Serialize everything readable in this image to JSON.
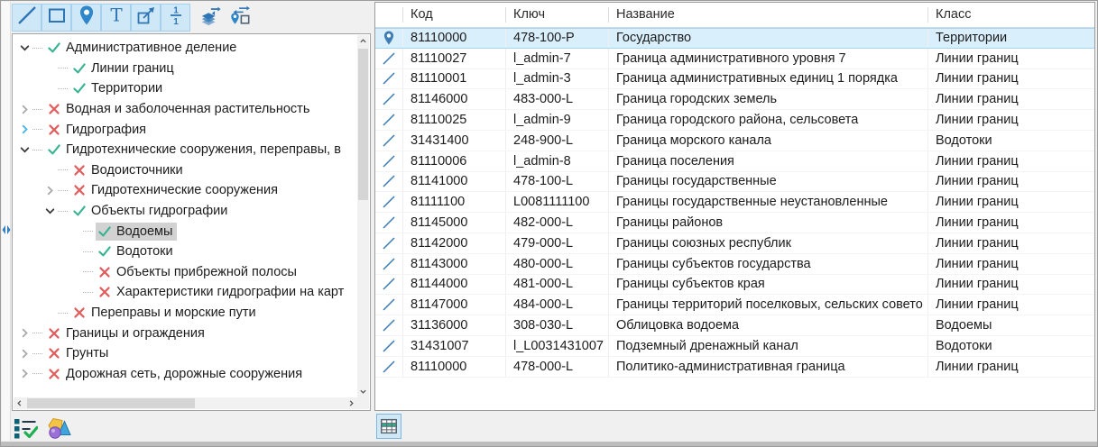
{
  "colors": {
    "accent_blue": "#2e75b6",
    "check_green": "#37b293",
    "cross_red": "#e25d5d",
    "table_selection_bg": "#daeffc",
    "tree_selection_bg": "#d2d2d2",
    "toolbar_toggle_bg": "#cfe8f8"
  },
  "toolbar": {
    "buttons": [
      {
        "id": "line-tool",
        "icon": "line",
        "active": true
      },
      {
        "id": "rectangle-tool",
        "icon": "rect",
        "active": true
      },
      {
        "id": "point-tool",
        "icon": "pin",
        "active": true
      },
      {
        "id": "text-tool",
        "icon": "text",
        "active": true
      },
      {
        "id": "vector-tool",
        "icon": "vector",
        "active": true
      },
      {
        "id": "scale-1-1-tool",
        "icon": "scale",
        "active": true
      },
      {
        "id": "layers-swap-tool",
        "icon": "layers",
        "active": false,
        "gap": true
      },
      {
        "id": "object-swap-tool",
        "icon": "pinbox",
        "active": false
      }
    ]
  },
  "tree": {
    "items": [
      {
        "label": "Административное деление",
        "level": 0,
        "expand": "open",
        "mark": "check",
        "selected": false
      },
      {
        "label": "Линии границ",
        "level": 1,
        "expand": "none",
        "mark": "check",
        "selected": false
      },
      {
        "label": "Территории",
        "level": 1,
        "expand": "none",
        "mark": "check",
        "selected": false
      },
      {
        "label": "Водная и заболоченная растительность",
        "level": 0,
        "expand": "closed",
        "mark": "cross",
        "selected": false
      },
      {
        "label": "Гидрография",
        "level": 0,
        "expand": "closed-blue",
        "mark": "cross",
        "selected": false
      },
      {
        "label": "Гидротехнические сооружения, переправы, в",
        "level": 0,
        "expand": "open",
        "mark": "check",
        "selected": false
      },
      {
        "label": "Водоисточники",
        "level": 1,
        "expand": "none",
        "mark": "cross",
        "selected": false
      },
      {
        "label": "Гидротехнические сооружения",
        "level": 1,
        "expand": "closed",
        "mark": "cross",
        "selected": false
      },
      {
        "label": "Объекты гидрографии",
        "level": 1,
        "expand": "open",
        "mark": "check",
        "selected": false
      },
      {
        "label": "Водоемы",
        "level": 2,
        "expand": "none",
        "mark": "check",
        "selected": true
      },
      {
        "label": "Водотоки",
        "level": 2,
        "expand": "none",
        "mark": "check",
        "selected": false
      },
      {
        "label": "Объекты прибрежной полосы",
        "level": 2,
        "expand": "none",
        "mark": "cross",
        "selected": false
      },
      {
        "label": "Характеристики гидрографии на карт",
        "level": 2,
        "expand": "none",
        "mark": "cross",
        "selected": false
      },
      {
        "label": "Переправы и морские пути",
        "level": 1,
        "expand": "none",
        "mark": "cross",
        "selected": false
      },
      {
        "label": "Границы и ограждения",
        "level": 0,
        "expand": "closed",
        "mark": "cross",
        "selected": false
      },
      {
        "label": "Грунты",
        "level": 0,
        "expand": "closed",
        "mark": "cross",
        "selected": false
      },
      {
        "label": "Дорожная сеть, дорожные сооружения",
        "level": 0,
        "expand": "closed",
        "mark": "cross",
        "selected": false
      }
    ]
  },
  "left_footer": {
    "icons": [
      {
        "id": "object-list-check"
      },
      {
        "id": "object-shapes"
      }
    ]
  },
  "table": {
    "columns": [
      "",
      "Код",
      "Ключ",
      "Название",
      "Класс"
    ],
    "rows": [
      {
        "icon": "pin",
        "code": "81110000",
        "key": "478-100-P",
        "name": "Государство",
        "cls": "Территории",
        "selected": true
      },
      {
        "icon": "line",
        "code": "81110027",
        "key": "l_admin-7",
        "name": "Граница административного уровня 7",
        "cls": "Линии границ",
        "selected": false
      },
      {
        "icon": "line",
        "code": "81110001",
        "key": "l_admin-3",
        "name": "Граница административных единиц 1 порядка",
        "cls": "Линии границ",
        "selected": false
      },
      {
        "icon": "line",
        "code": "81146000",
        "key": "483-000-L",
        "name": "Граница городских земель",
        "cls": "Линии границ",
        "selected": false
      },
      {
        "icon": "line",
        "code": "81110025",
        "key": "l_admin-9",
        "name": "Граница городского района, сельсовета",
        "cls": "Линии границ",
        "selected": false
      },
      {
        "icon": "line",
        "code": "31431400",
        "key": "248-900-L",
        "name": "Граница морского канала",
        "cls": "Водотоки",
        "selected": false
      },
      {
        "icon": "line",
        "code": "81110006",
        "key": "l_admin-8",
        "name": "Граница поселения",
        "cls": "Линии границ",
        "selected": false
      },
      {
        "icon": "line",
        "code": "81141000",
        "key": "478-100-L",
        "name": "Границы государственные",
        "cls": "Линии границ",
        "selected": false
      },
      {
        "icon": "line",
        "code": "81111100",
        "key": "L0081111100",
        "name": "Границы государственные неустановленные",
        "cls": "Линии границ",
        "selected": false
      },
      {
        "icon": "line",
        "code": "81145000",
        "key": "482-000-L",
        "name": "Границы районов",
        "cls": "Линии границ",
        "selected": false
      },
      {
        "icon": "line",
        "code": "81142000",
        "key": "479-000-L",
        "name": "Границы союзных республик",
        "cls": "Линии границ",
        "selected": false
      },
      {
        "icon": "line",
        "code": "81143000",
        "key": "480-000-L",
        "name": "Границы субъектов государства",
        "cls": "Линии границ",
        "selected": false
      },
      {
        "icon": "line",
        "code": "81144000",
        "key": "481-000-L",
        "name": "Границы субъектов края",
        "cls": "Линии границ",
        "selected": false
      },
      {
        "icon": "line",
        "code": "81147000",
        "key": "484-000-L",
        "name": "Границы территорий поселковых, сельских совето",
        "cls": "Линии границ",
        "selected": false
      },
      {
        "icon": "line",
        "code": "31136000",
        "key": "308-030-L",
        "name": "Облицовка водоема",
        "cls": "Водоемы",
        "selected": false
      },
      {
        "icon": "line",
        "code": "31431007",
        "key": "l_L0031431007",
        "name": "Подземный дренажный канал",
        "cls": "Водотоки",
        "selected": false
      },
      {
        "icon": "line",
        "code": "81110000",
        "key": "478-000-L",
        "name": "Политико-административная граница",
        "cls": "Линии границ",
        "selected": false
      }
    ]
  },
  "right_footer": {
    "icons": [
      {
        "id": "table-view",
        "active": true
      }
    ]
  }
}
